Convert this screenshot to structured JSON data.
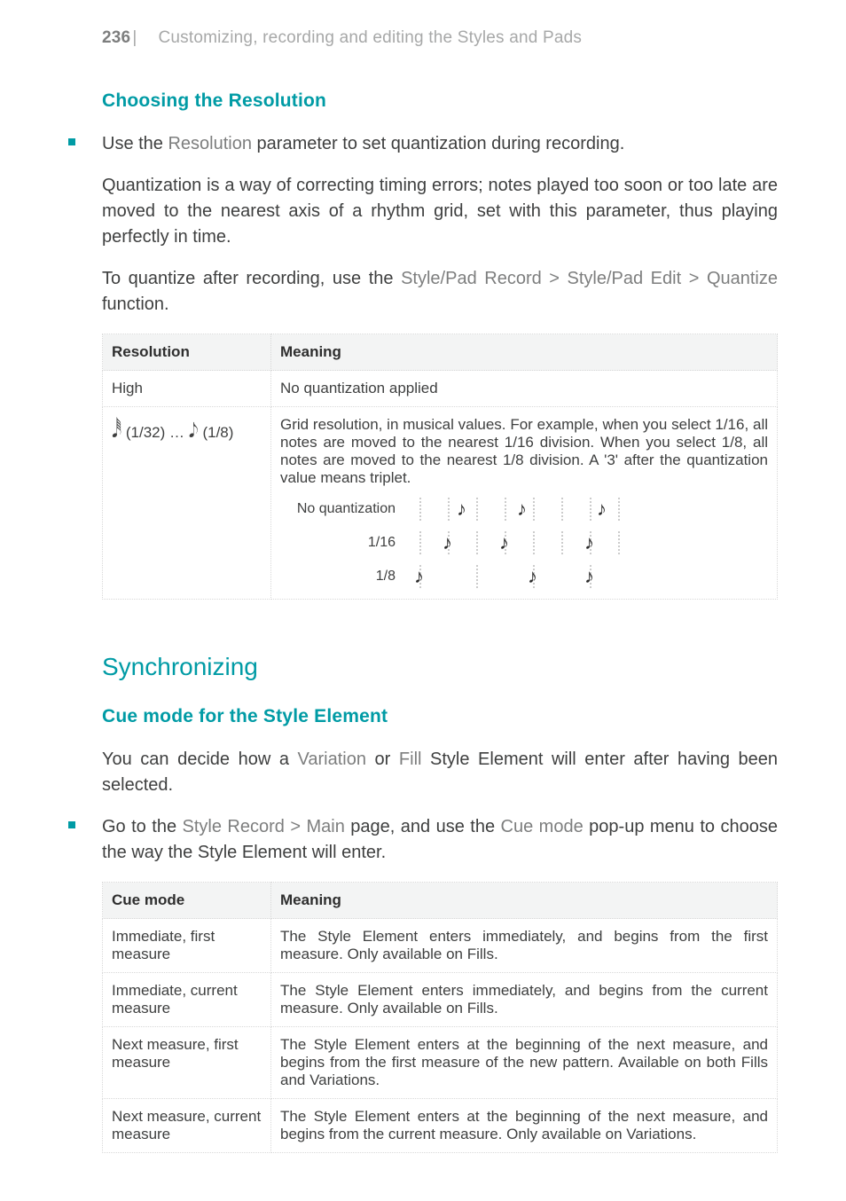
{
  "header": {
    "page_number": "236",
    "bar": "|",
    "chapter": "Customizing, recording and editing the Styles and Pads"
  },
  "section1": {
    "heading": "Choosing the Resolution",
    "bullet_pre": "Use the ",
    "bullet_mid": "Resolution",
    "bullet_post": " parameter to set quantization during recording.",
    "para2": "Quantization is a way of correcting timing errors; notes played too soon or too late are moved to the nearest axis of a rhythm grid, set with this parameter, thus playing perfectly in time.",
    "para3_pre": "To quantize after recording, use the ",
    "para3_mid": "Style/Pad Record > Style/Pad Edit > Quantize",
    "para3_post": " function.",
    "table": {
      "headers": {
        "c1": "Resolution",
        "c2": "Meaning"
      },
      "rows": [
        {
          "c1": "High",
          "c2": "No quantization applied"
        },
        {
          "c1_pre": "",
          "c1_mid": " (1/32) … ",
          "c1_post": " (1/8)",
          "c2": "Grid resolution, in musical values. For example, when you select 1/16, all notes are moved to the nearest 1/16 division. When you select 1/8, all notes are moved to the nearest 1/8 division. A '3' after the quantization value means triplet.",
          "ill": {
            "rows": [
              {
                "label": "No quantization"
              },
              {
                "label": "1/16"
              },
              {
                "label": "1/8"
              }
            ]
          }
        }
      ]
    }
  },
  "section2": {
    "heading": "Synchronizing",
    "sub": "Cue mode for the Style Element",
    "para1_pre": "You can decide how a ",
    "para1_mid1": "Variation",
    "para1_mid_or": " or ",
    "para1_mid2": "Fill",
    "para1_post": " Style Element will enter after having been selected.",
    "bullet_pre": "Go to the ",
    "bullet_mid1": "Style Record > Main",
    "bullet_mid_text": " page, and use the ",
    "bullet_mid2": "Cue mode",
    "bullet_post": " pop-up menu to choose the way the Style Element will enter.",
    "table": {
      "headers": {
        "c1": "Cue mode",
        "c2": "Meaning"
      },
      "rows": [
        {
          "c1": "Immediate, first measure",
          "c2": "The Style Element enters immediately, and begins from the first measure. Only available on Fills."
        },
        {
          "c1": "Immediate, current measure",
          "c2": "The Style Element enters immediately, and begins from the current measure. Only available on Fills."
        },
        {
          "c1": "Next measure, first measure",
          "c2": "The Style Element enters at the beginning of the next measure, and begins from the first measure of the new pattern. Available on both Fills and Variations."
        },
        {
          "c1": "Next measure, current measure",
          "c2": "The Style Element enters at the beginning of the next measure, and begins from the current measure. Only available on Variations."
        }
      ]
    }
  }
}
